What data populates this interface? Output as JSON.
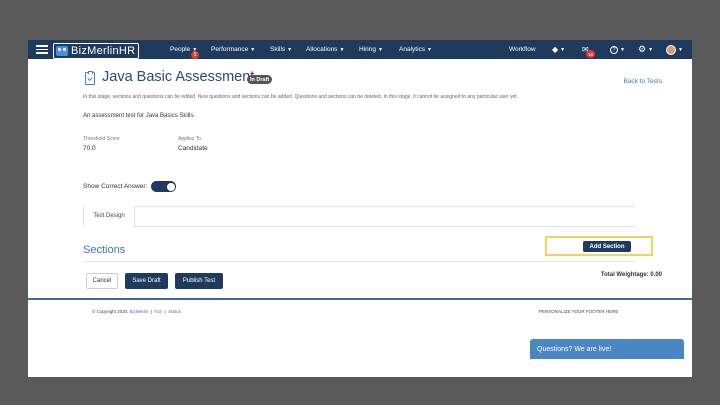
{
  "navbar": {
    "brand": "BizMerlinHR",
    "items": [
      {
        "label": "People",
        "badge": "3"
      },
      {
        "label": "Performance"
      },
      {
        "label": "Skills"
      },
      {
        "label": "Allocations"
      },
      {
        "label": "Hiring"
      },
      {
        "label": "Analytics"
      }
    ],
    "workflow_label": "Workflow",
    "mail_badge": "16"
  },
  "page": {
    "title": "Java Basic Assessment",
    "status_badge": "In Draft",
    "back_link": "Back to Tests",
    "stage_description": "In this stage, sections and questions can be edited. New questions and sections can be added. Questions and sections can be deleted. In this stage, it cannot be assigned to any particular user yet.",
    "test_description": "An assessment test for Java Basics Skills.",
    "threshold_label": "Threshold Score",
    "threshold_value": "70.0",
    "applies_label": "Applies To",
    "applies_value": "Candidate",
    "show_answer_label": "Show Correct Answer:",
    "show_answer_on": true,
    "tab_label": "Test Design",
    "sections_title": "Sections",
    "add_section_label": "Add Section",
    "cancel_label": "Cancel",
    "save_draft_label": "Save Draft",
    "publish_label": "Publish Test",
    "total_weightage": "Total Weightage: 0.00"
  },
  "footer": {
    "copyright": "© Copyright 2020,",
    "company_link": "BizMerlin",
    "tos_link": "ToS",
    "status_link": "Status",
    "separator": "|",
    "personalize": "PERSONALIZE YOUR FOOTER HERE"
  },
  "chat": {
    "label": "Questions? We are live!"
  },
  "colors": {
    "navbar": "#1f3a5f",
    "link": "#3c77b5",
    "highlight": "#f2d45c",
    "chat": "#4a86c4"
  }
}
